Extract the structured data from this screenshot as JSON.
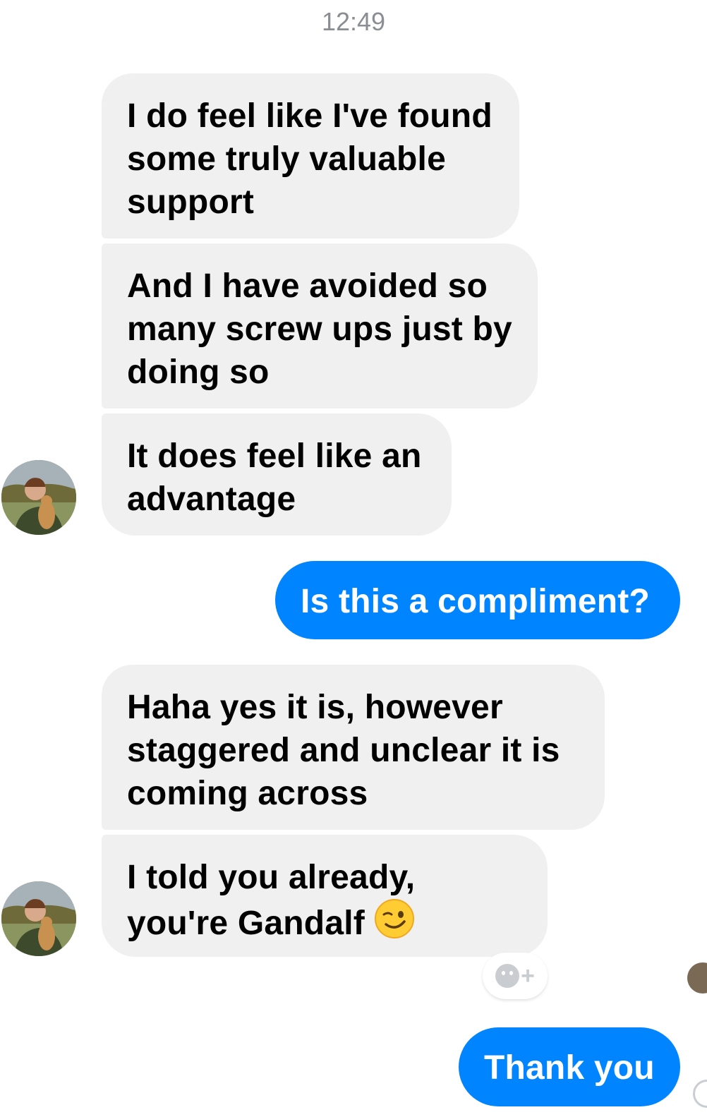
{
  "conversation": {
    "timestamp": "12:49",
    "messages": [
      {
        "direction": "incoming",
        "text": "I do feel like I've found some truly valuable support"
      },
      {
        "direction": "incoming",
        "text": "And I have avoided so many screw ups just by doing so"
      },
      {
        "direction": "incoming",
        "text": "It does feel like an advantage"
      },
      {
        "direction": "outgoing",
        "text": "Is this a compliment?"
      },
      {
        "direction": "incoming",
        "text": "Haha yes it is, however staggered and unclear it is coming across"
      },
      {
        "direction": "incoming",
        "text": "I told you already, you're Gandalf",
        "emoji": "winking-face-emoji"
      },
      {
        "direction": "outgoing",
        "text": "Thank you"
      }
    ]
  },
  "icons": {
    "reaction": "add-reaction-icon",
    "avatar": "contact-avatar"
  },
  "colors": {
    "incoming_bubble": "#f0f0f0",
    "outgoing_bubble": "#0084ff",
    "timestamp_text": "#8a8d91"
  }
}
